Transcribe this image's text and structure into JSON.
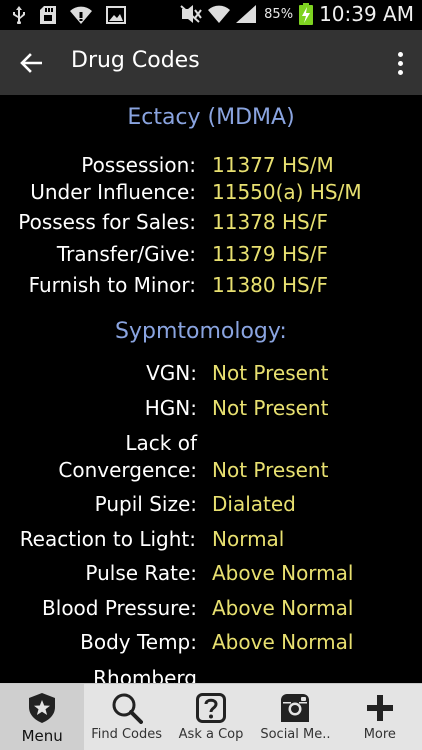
{
  "status_bar": {
    "battery_pct": "85%",
    "time": "10:39 AM",
    "left_icons": [
      "usb-icon",
      "sd-card-icon",
      "wifi-alert-icon",
      "image-icon"
    ],
    "right_icons": [
      "mute-icon",
      "wifi-icon",
      "signal-icon",
      "battery-charging-icon"
    ]
  },
  "toolbar": {
    "title": "Drug Codes",
    "back_icon": "arrow-left-icon",
    "overflow_icon": "more-vert-icon"
  },
  "content": {
    "title": "Ectacy (MDMA)",
    "codes": [
      {
        "label": "Possession:",
        "value": "11377 HS/M"
      },
      {
        "label": "Under Influence:",
        "value": "11550(a) HS/M"
      },
      {
        "label": "Possess for Sales:",
        "value": "11378 HS/F"
      },
      {
        "label": "Transfer/Give:",
        "value": "11379 HS/F"
      },
      {
        "label": "Furnish to Minor:",
        "value": "11380 HS/F"
      }
    ],
    "symptoms_heading": "Sypmtomology:",
    "symptoms": [
      {
        "label": "VGN:",
        "value": "Not Present"
      },
      {
        "label": "HGN:",
        "value": "Not Present"
      },
      {
        "label_line1": "Lack of",
        "label_line2": "Convergence:",
        "value": "Not Present"
      },
      {
        "label": "Pupil Size:",
        "value": "Dialated"
      },
      {
        "label": "Reaction to Light:",
        "value": "Normal"
      },
      {
        "label": "Pulse Rate:",
        "value": "Above Normal"
      },
      {
        "label": "Blood Pressure:",
        "value": "Above Normal"
      },
      {
        "label": "Body Temp:",
        "value": "Above Normal"
      },
      {
        "label": "Rhomberg",
        "value": ""
      }
    ]
  },
  "bottom_nav": [
    {
      "label": "Menu",
      "icon": "star-shield-icon",
      "active": true
    },
    {
      "label": "Find Codes",
      "icon": "search-icon",
      "active": false
    },
    {
      "label": "Ask a Cop",
      "icon": "question-icon",
      "active": false
    },
    {
      "label": "Social Me..",
      "icon": "instagram-icon",
      "active": false
    },
    {
      "label": "More",
      "icon": "plus-icon",
      "active": false
    }
  ],
  "colors": {
    "heading": "#8aa4e0",
    "value": "#e8e070",
    "toolbar": "#333333",
    "nav_bg": "#e4e4e4"
  }
}
